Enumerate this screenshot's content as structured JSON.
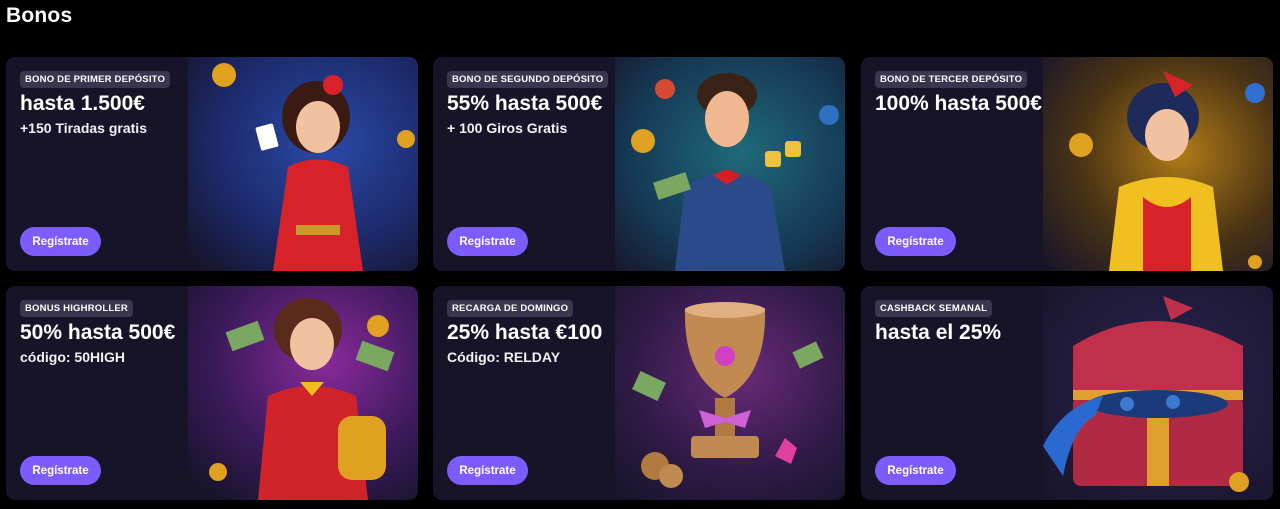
{
  "page": {
    "title": "Bonos"
  },
  "colors": {
    "card_bg": "#17142a",
    "button": "#7d5cff",
    "badge_bg": "#3a3650"
  },
  "cards": [
    {
      "badge": "BONO DE PRIMER DEPÓSITO",
      "headline": "hasta 1.500€",
      "sub": "+150 Tiradas gratis",
      "button": "Regístrate",
      "art": "pinup-woman-cards-illustration"
    },
    {
      "badge": "BONO DE SEGUNDO DEPÓSITO",
      "headline": "55% hasta 500€",
      "sub": "+ 100 Giros Gratis",
      "button": "Regístrate",
      "art": "gentleman-dice-illustration"
    },
    {
      "badge": "BONO DE TERCER DEPÓSITO",
      "headline": "100% hasta 500€",
      "sub": "",
      "button": "Regístrate",
      "art": "pinup-woman-chips-illustration"
    },
    {
      "badge": "BONUS HIGHROLLER",
      "headline": "50% hasta 500€",
      "sub": "código: 50HIGH",
      "button": "Regístrate",
      "art": "woman-money-bag-illustration"
    },
    {
      "badge": "RECARGA DE DOMINGO",
      "headline": "25% hasta €100",
      "sub": "Código: RELDAY",
      "button": "Regístrate",
      "art": "trophy-illustration"
    },
    {
      "badge": "CASHBACK SEMANAL",
      "headline": "hasta el 25%",
      "sub": "",
      "button": "Regístrate",
      "art": "cashback-chest-illustration"
    }
  ]
}
